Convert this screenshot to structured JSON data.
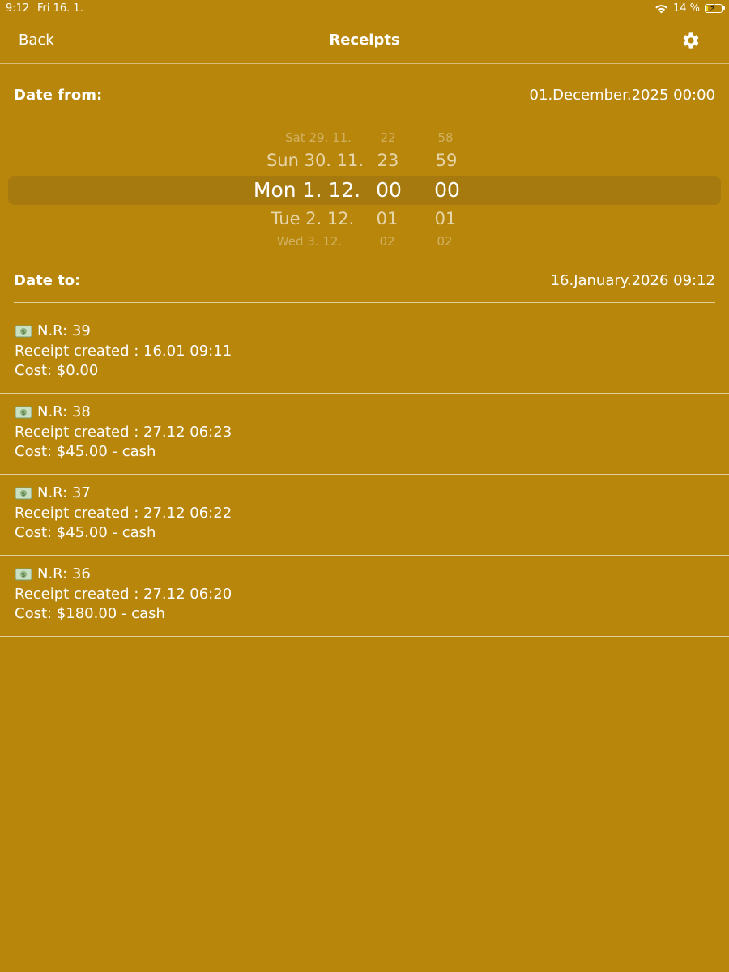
{
  "status_bar": {
    "time": "9:12",
    "date": "Fri 16. 1.",
    "battery_text": "14 %",
    "battery_level": 0.14,
    "icons": [
      "wifi-icon",
      "battery-charging-icon"
    ]
  },
  "nav": {
    "back_label": "Back",
    "title": "Receipts",
    "settings_icon": "gear-icon"
  },
  "date_from": {
    "label": "Date from:",
    "value": "01.December.2025 00:00"
  },
  "picker": {
    "days": [
      "Sat 29. 11.",
      "Sun 30. 11.",
      "Mon 1. 12.",
      "Tue 2. 12.",
      "Wed 3. 12."
    ],
    "hours": [
      "22",
      "23",
      "00",
      "01",
      "02"
    ],
    "minutes": [
      "58",
      "59",
      "00",
      "01",
      "02"
    ],
    "selected_index": 2
  },
  "date_to": {
    "label": "Date to:",
    "value": "16.January.2026 09:12"
  },
  "receipts": [
    {
      "icon": "money-icon",
      "number": "N.R: 39",
      "created": "Receipt created : 16.01 09:11",
      "cost": "Cost: $0.00"
    },
    {
      "icon": "money-icon",
      "number": "N.R: 38",
      "created": "Receipt created : 27.12 06:23",
      "cost": "Cost: $45.00 - cash"
    },
    {
      "icon": "money-icon",
      "number": "N.R: 37",
      "created": "Receipt created : 27.12 06:22",
      "cost": "Cost: $45.00 - cash"
    },
    {
      "icon": "money-icon",
      "number": "N.R: 36",
      "created": "Receipt created : 27.12 06:20",
      "cost": "Cost: $180.00 - cash"
    }
  ],
  "colors": {
    "background": "#b8860b",
    "text": "#ffffff",
    "battery_fill": "#f1d31b"
  }
}
